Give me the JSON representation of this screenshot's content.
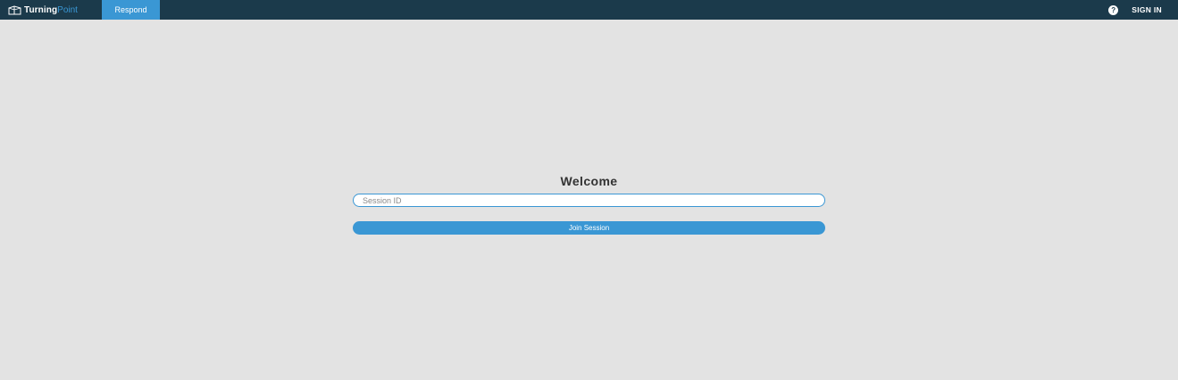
{
  "header": {
    "brand_part1": "Turning",
    "brand_part2": "Point",
    "logo_icon": "turningpoint-logo-icon",
    "tabs": [
      {
        "label": "Respond",
        "active": true
      }
    ],
    "help_icon": "help-icon",
    "help_glyph": "?",
    "sign_in_label": "SIGN IN"
  },
  "main": {
    "title": "Welcome",
    "session_input": {
      "value": "",
      "placeholder": "Session ID"
    },
    "join_button_label": "Join Session"
  },
  "colors": {
    "topbar": "#1b3a4b",
    "accent": "#3a97d4",
    "background": "#e3e3e3"
  }
}
